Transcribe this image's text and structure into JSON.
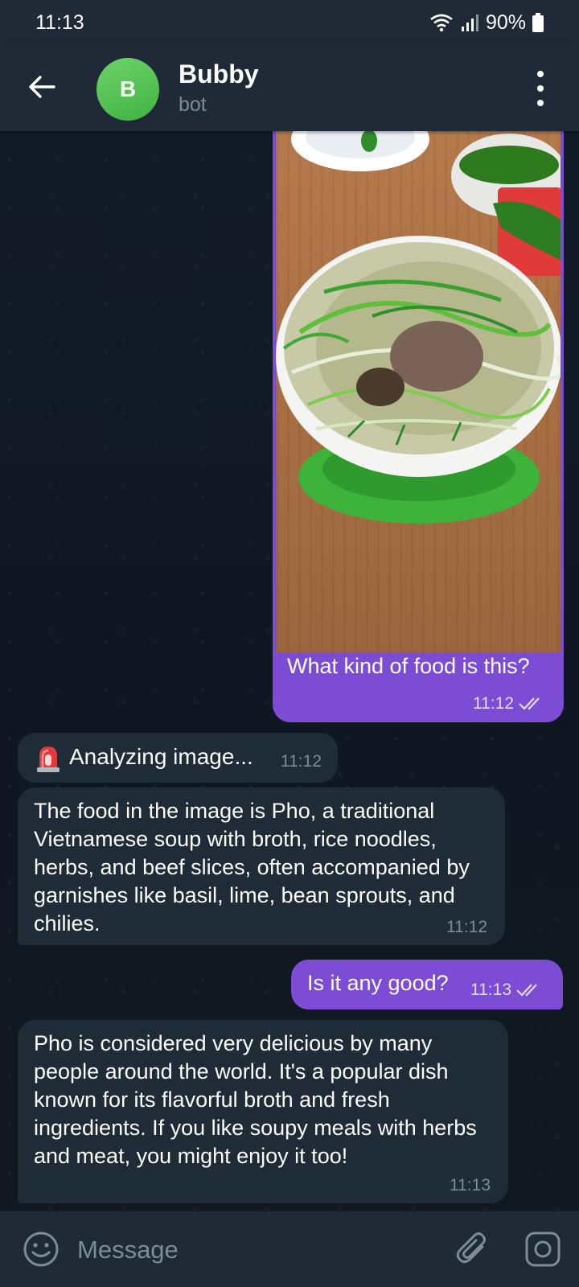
{
  "status_bar": {
    "time": "11:13",
    "battery": "90%",
    "icons": [
      "wifi-icon",
      "signal-icon",
      "battery-icon"
    ]
  },
  "header": {
    "avatar_letter": "B",
    "title": "Bubby",
    "subtitle": "bot",
    "back_icon": "arrow-left-icon",
    "menu_icon": "more-vertical-icon"
  },
  "messages": [
    {
      "direction": "outgoing",
      "type": "photo",
      "caption": "What kind of food is this?",
      "time": "11:12",
      "read": true
    },
    {
      "direction": "incoming",
      "type": "status",
      "icon": "alert-siren-icon",
      "text": "Analyzing image...",
      "time": "11:12"
    },
    {
      "direction": "incoming",
      "type": "text",
      "text": "The food in the image is Pho, a traditional Vietnamese soup with broth, rice noodles, herbs, and beef slices, often accompanied by garnishes like basil, lime, bean sprouts, and chilies.",
      "time": "11:12"
    },
    {
      "direction": "outgoing",
      "type": "text",
      "text": "Is it any good?",
      "time": "11:13",
      "read": true
    },
    {
      "direction": "incoming",
      "type": "text",
      "text": "Pho is considered very delicious by many people around the world. It's a popular dish known for its flavorful broth and fresh ingredients. If you like soupy meals with herbs and meat, you might enjoy it too!",
      "time": "11:13"
    }
  ],
  "composer": {
    "placeholder": "Message",
    "icons": [
      "emoji-icon",
      "paperclip-icon",
      "camera-icon"
    ]
  },
  "colors": {
    "background": "#0e1621",
    "header": "#1f2a36",
    "incoming_bubble": "#1f2b36",
    "outgoing_bubble": "#7c4dd4",
    "avatar": "#4fc24c",
    "muted_text": "#7f8b97"
  }
}
